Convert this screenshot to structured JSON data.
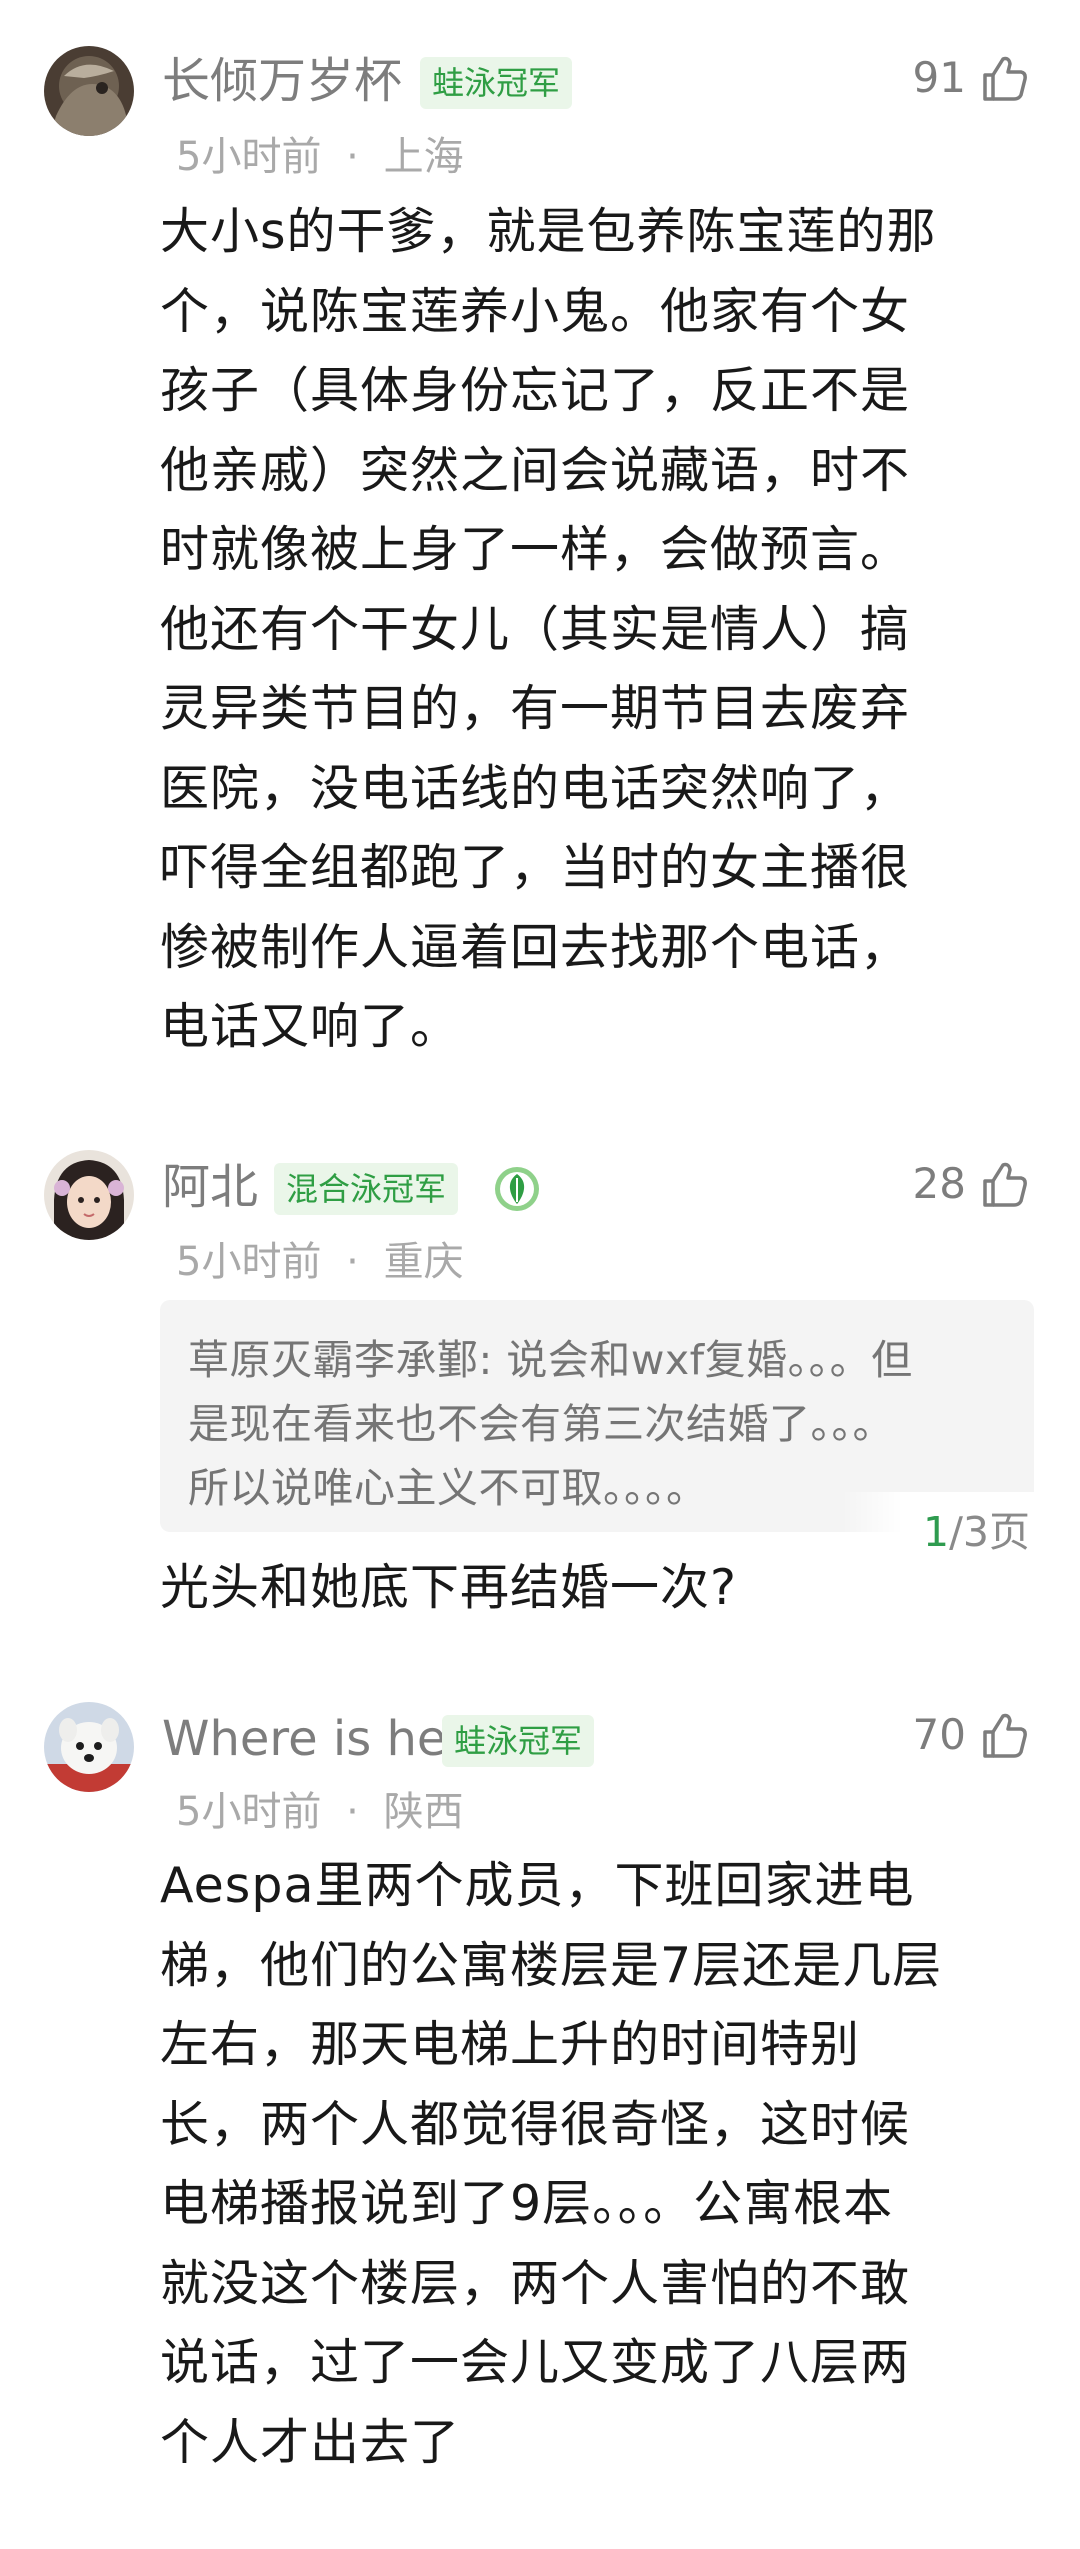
{
  "comments": [
    {
      "username": "长倾万岁杯",
      "badge": "蛙泳冠军",
      "likes": "91",
      "time": "5小时前",
      "location": "上海",
      "lines": [
        "大小s的干爹，就是包养陈宝莲的那",
        "个，说陈宝莲养小鬼。他家有个女",
        "孩子（具体身份忘记了，反正不是",
        "他亲戚）突然之间会说藏语，时不",
        "时就像被上身了一样，会做预言。",
        "他还有个干女儿（其实是情人）搞",
        "灵异类节目的，有一期节目去废弃",
        "医院，没电话线的电话突然响了，",
        "吓得全组都跑了，当时的女主播很",
        "惨被制作人逼着回去找那个电话，",
        "电话又响了。"
      ]
    },
    {
      "username": "阿北",
      "badge": "混合泳冠军",
      "likes": "28",
      "time": "5小时前",
      "location": "重庆",
      "quote_lines": [
        "草原灭霸李承鄞: 说会和wxf复婚。。。但",
        "是现在看来也不会有第三次结婚了。。。",
        "所以说唯心主义不可取。。。。"
      ],
      "pager_current": "1",
      "pager_total": "/3页",
      "lines": [
        "光头和她底下再结婚一次?"
      ]
    },
    {
      "username": "Where is he",
      "badge": "蛙泳冠军",
      "likes": "70",
      "time": "5小时前",
      "location": "陕西",
      "lines": [
        "Aespa里两个成员，下班回家进电",
        "梯，他们的公寓楼层是7层还是几层",
        "左右，那天电梯上升的时间特别",
        "长，两个人都觉得很奇怪，这时候",
        "电梯播报说到了9层。。。公寓根本",
        "就没这个楼层，两个人害怕的不敢",
        "说话，过了一会儿又变成了八层两",
        "个人才出去了"
      ]
    }
  ],
  "separator": "·",
  "colors": {
    "badge_bg": "#eaf6e9",
    "badge_text": "#2f9e44",
    "username": "#7d7d7d",
    "meta": "#a9a9a9",
    "body": "#191919",
    "quote_bg": "#f4f4f4",
    "pager_current": "#2e9b4f"
  },
  "icons": {
    "like": "thumbs-up-icon",
    "medal": "green-leaf-medal-icon"
  }
}
